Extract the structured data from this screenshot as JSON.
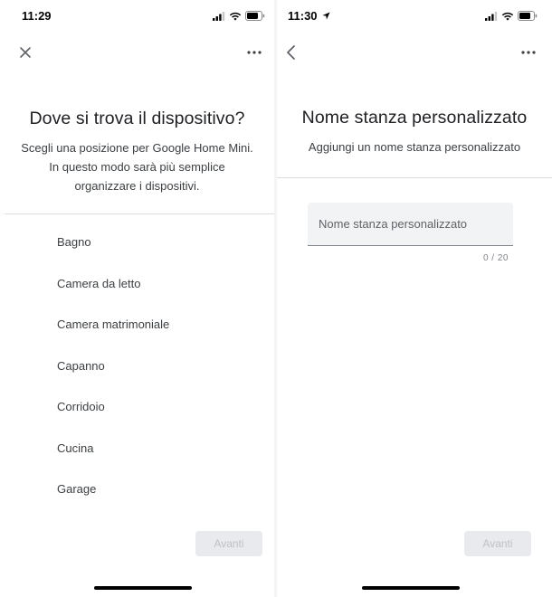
{
  "colors": {
    "text": "#202124",
    "secondary": "#3c4043",
    "divider": "#dadce0",
    "button_disabled_bg": "#e8eaed",
    "button_disabled_text": "#bdc1c6"
  },
  "left_screen": {
    "status": {
      "time": "11:29"
    },
    "topbar": {
      "nav_icon": "close-icon",
      "menu_icon": "more-horizontal-icon"
    },
    "title": "Dove si trova il dispositivo?",
    "subtitle": "Scegli una posizione per Google Home Mini. In questo modo sarà più semplice organizzare i dispositivi.",
    "rooms": [
      "Bagno",
      "Camera da letto",
      "Camera matrimoniale",
      "Capanno",
      "Corridoio",
      "Cucina",
      "Garage"
    ],
    "next_label": "Avanti"
  },
  "right_screen": {
    "status": {
      "time": "11:30",
      "location_icon": "location-arrow-icon"
    },
    "topbar": {
      "nav_icon": "back-chevron-icon",
      "menu_icon": "more-horizontal-icon"
    },
    "title": "Nome stanza personalizzato",
    "subtitle": "Aggiungi un nome stanza personalizzato",
    "input": {
      "value": "",
      "placeholder": "Nome stanza personalizzato"
    },
    "counter": "0 / 20",
    "next_label": "Avanti"
  }
}
